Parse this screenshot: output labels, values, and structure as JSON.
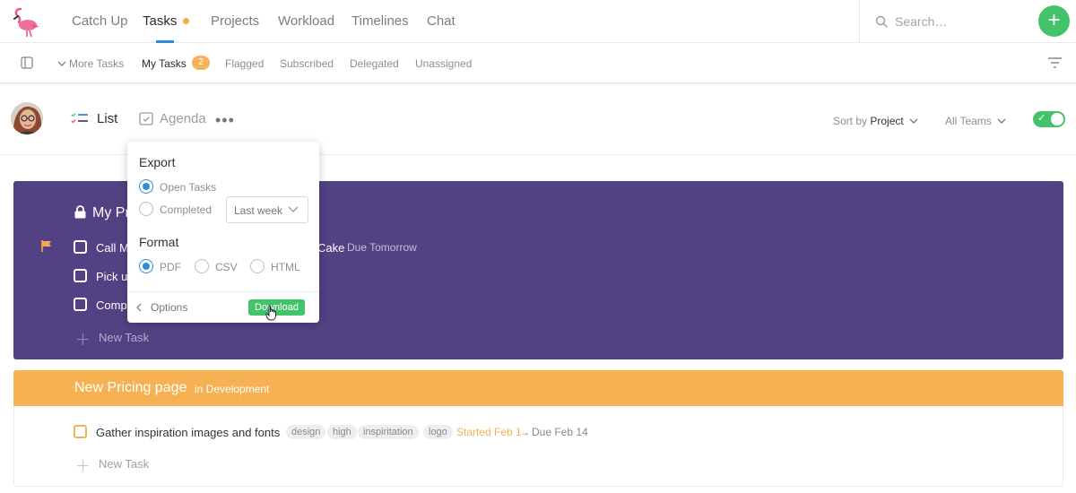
{
  "topnav": {
    "tabs": [
      {
        "label": "Catch Up"
      },
      {
        "label": "Tasks"
      },
      {
        "label": "Projects"
      },
      {
        "label": "Workload"
      },
      {
        "label": "Timelines"
      },
      {
        "label": "Chat"
      }
    ],
    "active_tab": "Tasks",
    "search_placeholder": "Search…",
    "add_label": "+"
  },
  "subnav": {
    "items": [
      {
        "label": "More Tasks"
      },
      {
        "label": "My Tasks"
      },
      {
        "label": "Flagged"
      },
      {
        "label": "Subscribed"
      },
      {
        "label": "Delegated"
      },
      {
        "label": "Unassigned"
      }
    ],
    "my_tasks_count": "2"
  },
  "viewbar": {
    "list_label": "List",
    "agenda_label": "Agenda",
    "more_label": "•••",
    "sort_prefix": "Sort by",
    "sort_value": "Project",
    "teams_label": "All Teams",
    "toggle_on": true
  },
  "projects": [
    {
      "title": "My Pr",
      "color": "#524283",
      "tasks": [
        {
          "text": "Call M",
          "flagged": true,
          "tail": "Cake",
          "due": "Due Tomorrow"
        },
        {
          "text": "Pick u"
        },
        {
          "text": "Compl"
        }
      ],
      "new_task_label": "New Task"
    },
    {
      "title": "New Pricing page",
      "status": "in Development",
      "color": "#f5b152",
      "tasks": [
        {
          "text": "Gather inspiration images and fonts",
          "tags": [
            "design",
            "high",
            "inspiritation",
            "logo"
          ],
          "started": "Started Feb 1",
          "arrow": "→",
          "due": "Due Feb 14"
        }
      ],
      "new_task_label": "New Task"
    }
  ],
  "export_popover": {
    "export_heading": "Export",
    "export_options": [
      {
        "label": "Open Tasks",
        "selected": true
      },
      {
        "label": "Completed",
        "selected": false
      }
    ],
    "range_value": "Last week",
    "format_heading": "Format",
    "format_options": [
      {
        "label": "PDF",
        "selected": true
      },
      {
        "label": "CSV",
        "selected": false
      },
      {
        "label": "HTML",
        "selected": false
      }
    ],
    "options_label": "Options",
    "download_label": "Download"
  },
  "colors": {
    "accent_blue": "#2f8cdd",
    "green": "#44c46a",
    "orange": "#f5b152",
    "purple": "#524283"
  }
}
